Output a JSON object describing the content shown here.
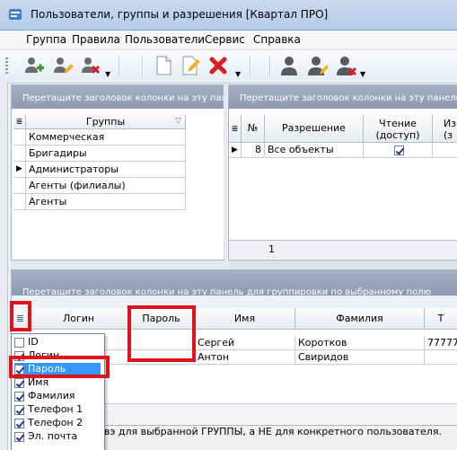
{
  "window": {
    "title": "Пользователи, группы и разрешения [Квартал ПРО]"
  },
  "menu": [
    "Группа",
    "Правила",
    "Пользователи",
    "Сервис",
    "Справка"
  ],
  "toolbar": {
    "icons": [
      "add-group-icon",
      "edit-group-icon",
      "delete-group-icon",
      "new-document-icon",
      "edit-document-icon",
      "delete-icon",
      "user-icon",
      "edit-user-icon",
      "delete-user-icon"
    ]
  },
  "groups_panel": {
    "group_hint": "Перетащите заголовок колонки на эту пан",
    "column": "Группы",
    "rows": [
      "Коммерческая",
      "Бригадиры",
      "Администраторы",
      "Агенты (филиалы)",
      "Агенты"
    ],
    "current_row_marker": "▶"
  },
  "permissions_panel": {
    "group_hint": "Перетащите заголовок колонки на эту панель для гру",
    "columns": {
      "num": "№",
      "permission": "Разрешение",
      "read_line1": "Чтение",
      "read_line2": "(доступ)",
      "change_line1": "Изм",
      "change_line2": "(з"
    },
    "rows": [
      {
        "num": "8",
        "permission": "Все объекты",
        "read": true
      }
    ],
    "footer_count": "1"
  },
  "users_panel": {
    "group_hint": "Перетащите заголовок колонки на эту панель для группировки по выбранному полю",
    "columns": {
      "login": "Логин",
      "password": "Пароль",
      "name": "Имя",
      "surname": "Фамилия",
      "phone": "Т"
    },
    "rows": [
      {
        "name": "Сергей",
        "surname": "Коротков",
        "phone": "777777"
      },
      {
        "name": "Антон",
        "surname": "Свиридов",
        "phone": ""
      }
    ]
  },
  "column_chooser": {
    "items": [
      {
        "label": "ID",
        "checked": false
      },
      {
        "label": "Логин",
        "checked": true
      },
      {
        "label": "Пароль",
        "checked": true
      },
      {
        "label": "Имя",
        "checked": true
      },
      {
        "label": "Фамилия",
        "checked": true
      },
      {
        "label": "Телефон 1",
        "checked": true
      },
      {
        "label": "Телефон 2",
        "checked": true
      },
      {
        "label": "Эл. почта",
        "checked": true
      }
    ]
  },
  "status": {
    "archive_label": "Удален в архивэ для выбранной ГРУППЫ, а НЕ для конкретного пользователя.",
    "archive_checked": true
  },
  "colors": {
    "highlight": "#e0121b",
    "selection": "#3399ff",
    "group_header": "#96a5bb"
  }
}
